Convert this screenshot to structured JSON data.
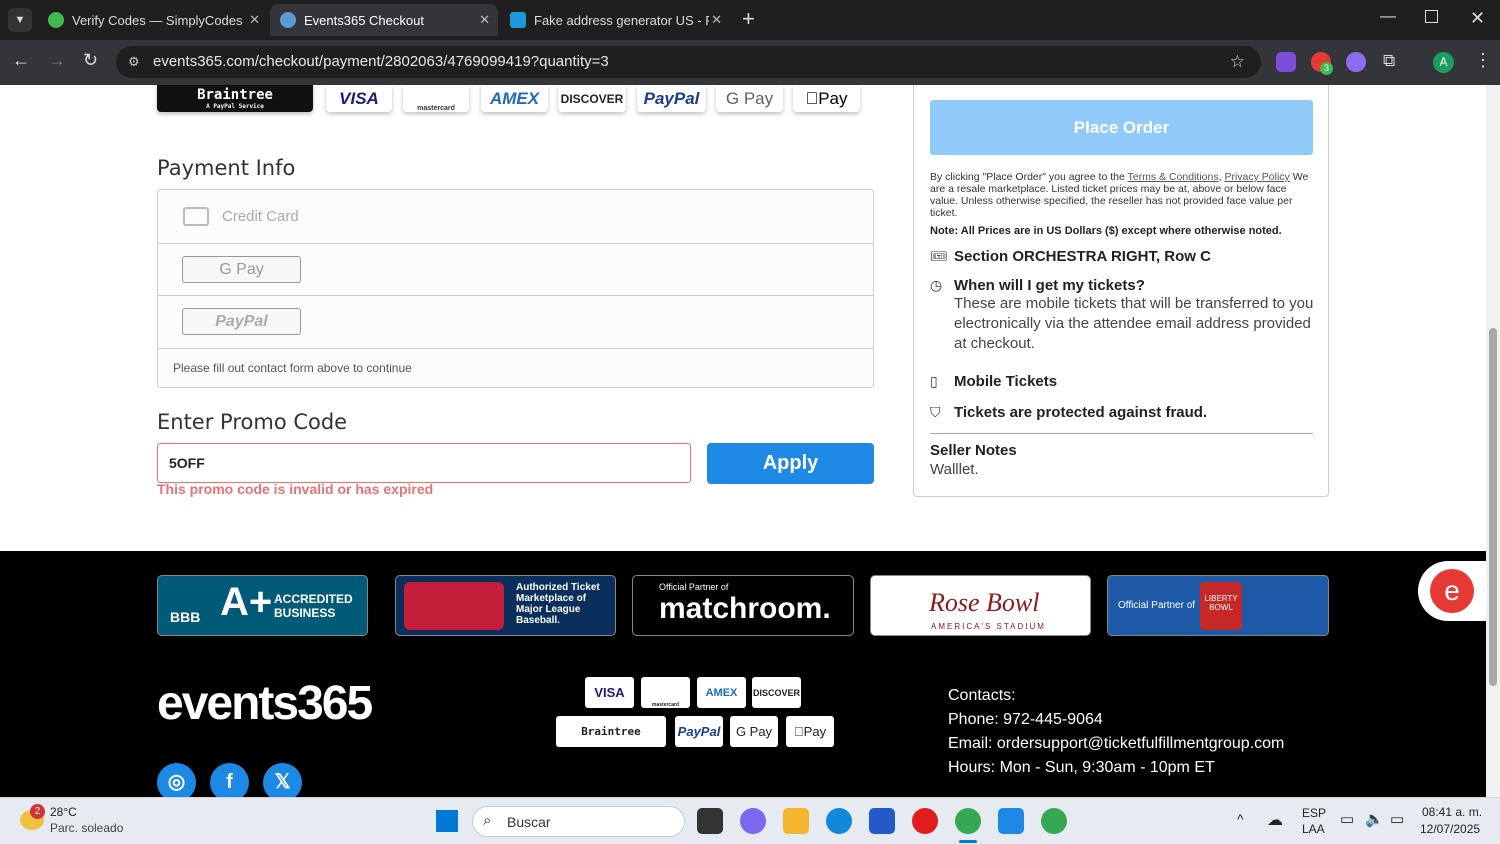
{
  "browser": {
    "tabs": [
      {
        "title": "Verify Codes — SimplyCodes",
        "close": "✕",
        "color": "#3fb950"
      },
      {
        "title": "Events365 Checkout",
        "close": "✕",
        "color": "#5b9bd5"
      },
      {
        "title": "Fake address generator US - Ra",
        "close": "✕",
        "color": "#1a9ad6"
      }
    ],
    "new_tab": "+",
    "url": "events365.com/checkout/payment/2802063/4769099419?quantity=3",
    "ext_badge": "3",
    "profile": "A"
  },
  "payment_logos": [
    "Braintree",
    "VISA",
    "mastercard",
    "AMEX",
    "DISCOVER",
    "PayPal",
    "G Pay",
    "Pay"
  ],
  "braintree_sub": "A PayPal Service",
  "payment_info": {
    "title": "Payment Info",
    "credit_card": "Credit Card",
    "gpay": "G Pay",
    "paypal": "PayPal",
    "notice": "Please fill out contact form above to continue"
  },
  "promo": {
    "title": "Enter Promo Code",
    "value": "5OFF",
    "apply": "Apply",
    "error": "This promo code is invalid or has expired"
  },
  "summary": {
    "place_order": "Place Order",
    "terms_prefix": "By clicking \"Place Order\" you agree to the",
    "terms_link": "Terms & Conditions",
    "privacy_link": "Privacy Policy",
    "terms_rest": "We are a resale marketplace. Listed ticket prices may be at, above or below face value. Unless otherwise specified, the reseller has not provided face value per ticket.",
    "note": "Note: All Prices are in US Dollars ($) except where otherwise noted.",
    "section": "Section ORCHESTRA RIGHT, Row C",
    "when_title": "When will I get my tickets?",
    "when_desc": "These are mobile tickets that will be transferred to you electronically via the attendee email address provided at checkout.",
    "mobile": "Mobile Tickets",
    "protected": "Tickets are protected against fraud.",
    "seller_notes_title": "Seller Notes",
    "seller_notes": "Walllet."
  },
  "footer": {
    "bbb": "BBB",
    "bbb_text": "ACCREDITED BUSINESS",
    "mlb_text": "Authorized Ticket Marketplace of Major League Baseball.",
    "matchroom_small": "Official Partner of",
    "matchroom": "matchroom.",
    "rosebowl": "Rose Bowl",
    "rosebowl_sub": "AMERICA'S STADIUM",
    "liberty_small": "Official Partner of",
    "liberty": "LIBERTY BOWL",
    "brand": "events365",
    "cards": [
      "VISA",
      "mastercard",
      "AMEX",
      "DISCOVER"
    ],
    "cards2": [
      "Braintree",
      "PayPal",
      "G Pay",
      "Pay"
    ],
    "contacts_title": "Contacts:",
    "phone": "Phone: 972-445-9064",
    "email": "Email: ordersupport@ticketfulfillmentgroup.com",
    "hours": "Hours: Mon - Sun, 9:30am - 10pm ET"
  },
  "taskbar": {
    "weather_badge": "2",
    "temp": "28°C",
    "condition": "Parc. soleado",
    "search": "Buscar",
    "lang1": "ESP",
    "lang2": "LAA",
    "time": "08:41 a. m.",
    "date": "12/07/2025"
  }
}
